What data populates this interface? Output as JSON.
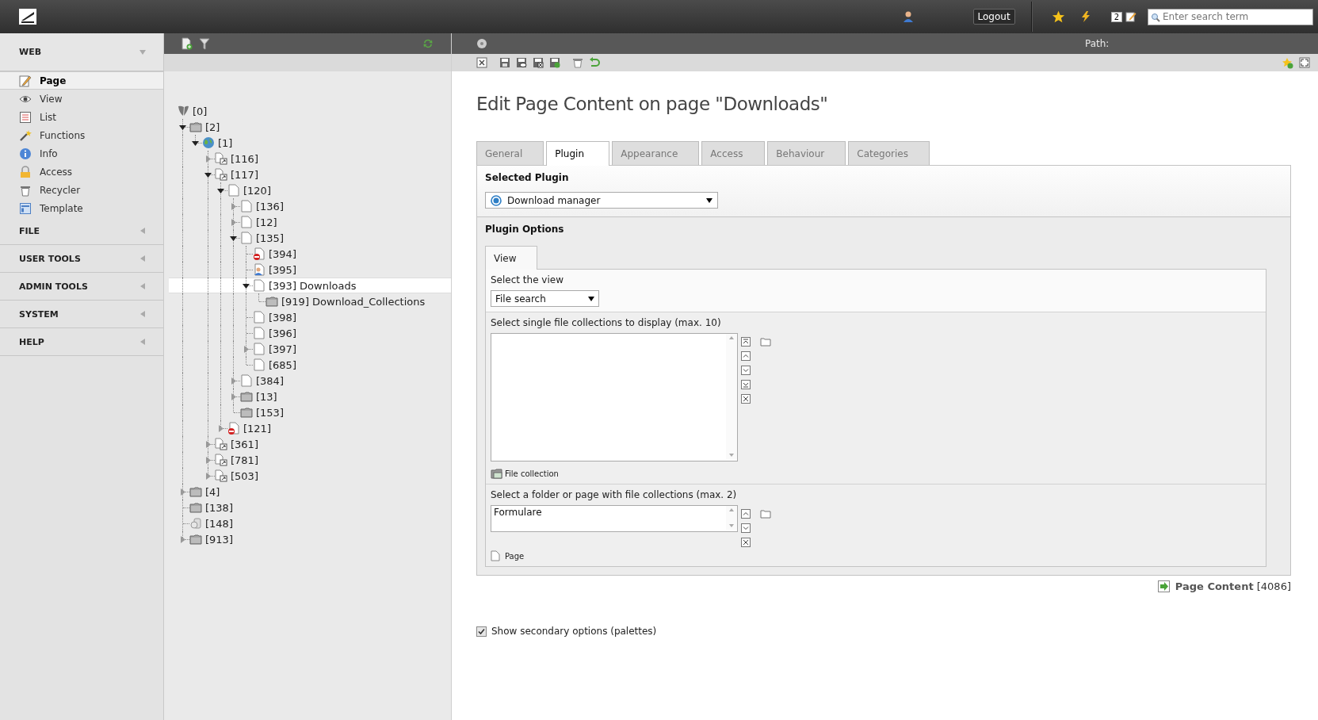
{
  "topbar": {
    "logout": "Logout",
    "badge": "2",
    "search": {
      "placeholder": "Enter search term"
    }
  },
  "modules": [
    {
      "label": "WEB",
      "expanded": true,
      "items": [
        {
          "label": "Page",
          "kind": "edit",
          "selected": true
        },
        {
          "label": "View",
          "kind": "eye",
          "selected": false
        },
        {
          "label": "List",
          "kind": "list",
          "selected": false
        },
        {
          "label": "Functions",
          "kind": "wand",
          "selected": false
        },
        {
          "label": "Info",
          "kind": "info",
          "selected": false
        },
        {
          "label": "Access",
          "kind": "lock",
          "selected": false
        },
        {
          "label": "Recycler",
          "kind": "trash",
          "selected": false
        },
        {
          "label": "Template",
          "kind": "template",
          "selected": false
        }
      ]
    },
    {
      "label": "FILE",
      "expanded": false
    },
    {
      "label": "USER TOOLS",
      "expanded": false
    },
    {
      "label": "ADMIN TOOLS",
      "expanded": false
    },
    {
      "label": "SYSTEM",
      "expanded": false
    },
    {
      "label": "HELP",
      "expanded": false
    }
  ],
  "docheader": {
    "path_label": "Path:"
  },
  "tree": [
    {
      "label": "[0]",
      "kind": "root",
      "selected": false,
      "children": [
        {
          "label": "[2]",
          "kind": "folder",
          "expanded": true,
          "selected": false,
          "children": [
            {
              "label": "[1]",
              "kind": "globe",
              "expanded": true,
              "selected": false,
              "children": [
                {
                  "label": "[116]",
                  "kind": "shortcut",
                  "expanded": false,
                  "selected": false
                },
                {
                  "label": "[117]",
                  "kind": "shortcut",
                  "expanded": true,
                  "selected": false,
                  "children": [
                    {
                      "label": "[120]",
                      "kind": "page",
                      "expanded": true,
                      "selected": false,
                      "children": [
                        {
                          "label": "[136]",
                          "kind": "page",
                          "expanded": false,
                          "selected": false
                        },
                        {
                          "label": "[12]",
                          "kind": "page",
                          "expanded": false,
                          "selected": false
                        },
                        {
                          "label": "[135]",
                          "kind": "page",
                          "expanded": true,
                          "selected": false,
                          "children": [
                            {
                              "label": "[394]",
                              "kind": "hidden",
                              "selected": false
                            },
                            {
                              "label": "[395]",
                              "kind": "user",
                              "selected": false
                            },
                            {
                              "label": "[393] Downloads",
                              "kind": "page",
                              "expanded": true,
                              "selected": true,
                              "children": [
                                {
                                  "label": "[919] Download_Collections",
                                  "kind": "folder",
                                  "selected": false
                                }
                              ]
                            },
                            {
                              "label": "[398]",
                              "kind": "page",
                              "selected": false
                            },
                            {
                              "label": "[396]",
                              "kind": "page",
                              "selected": false
                            },
                            {
                              "label": "[397]",
                              "kind": "page",
                              "expanded": false,
                              "selected": false
                            },
                            {
                              "label": "[685]",
                              "kind": "page",
                              "selected": false
                            }
                          ]
                        },
                        {
                          "label": "[384]",
                          "kind": "page",
                          "expanded": false,
                          "selected": false
                        },
                        {
                          "label": "[13]",
                          "kind": "folder",
                          "expanded": false,
                          "selected": false
                        },
                        {
                          "label": "[153]",
                          "kind": "folder",
                          "selected": false
                        }
                      ]
                    },
                    {
                      "label": "[121]",
                      "kind": "hidden",
                      "expanded": false,
                      "selected": false
                    }
                  ]
                },
                {
                  "label": "[361]",
                  "kind": "shortcut",
                  "expanded": false,
                  "selected": false
                },
                {
                  "label": "[781]",
                  "kind": "shortcut",
                  "expanded": false,
                  "selected": false
                },
                {
                  "label": "[503]",
                  "kind": "shortcut",
                  "expanded": false,
                  "selected": false
                }
              ]
            }
          ]
        },
        {
          "label": "[4]",
          "kind": "folder",
          "expanded": false,
          "selected": false
        },
        {
          "label": "[138]",
          "kind": "folder",
          "selected": false
        },
        {
          "label": "[148]",
          "kind": "storage",
          "selected": false
        },
        {
          "label": "[913]",
          "kind": "folder",
          "expanded": false,
          "selected": false
        }
      ]
    }
  ],
  "title": "Edit Page Content on page \"Downloads\"",
  "tabs": [
    {
      "label": "General",
      "selected": false
    },
    {
      "label": "Plugin",
      "selected": true
    },
    {
      "label": "Appearance",
      "selected": false
    },
    {
      "label": "Access",
      "selected": false
    },
    {
      "label": "Behaviour",
      "selected": false
    },
    {
      "label": "Categories",
      "selected": false
    }
  ],
  "selected_plugin": {
    "heading": "Selected Plugin",
    "value": "Download manager"
  },
  "plugin_options": {
    "heading": "Plugin Options",
    "tabs": [
      {
        "label": "View",
        "selected": true
      }
    ],
    "view": {
      "label": "Select the view",
      "value": "File search"
    },
    "collections": {
      "label": "Select single file collections to display (max. 10)",
      "add_label": "File collection"
    },
    "folder": {
      "label": "Select a folder or page with file collections (max. 2)",
      "items": [
        "Formulare"
      ],
      "add_label": "Page"
    }
  },
  "record": {
    "type": "Page Content",
    "uid": "[4086]"
  },
  "secondary_options": {
    "label": "Show secondary options (palettes)",
    "checked": true
  }
}
